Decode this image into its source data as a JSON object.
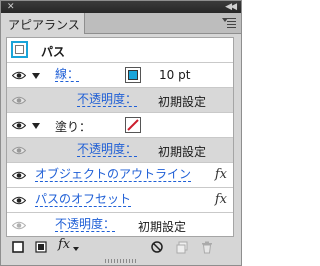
{
  "panel": {
    "title_tab": "アピアランス",
    "close_glyph": "✕",
    "collapse_glyph": "◀◀"
  },
  "header": {
    "object_label": "パス"
  },
  "rows": [
    {
      "label": "線：",
      "value": "10 pt",
      "stroke_color": "#1aa4d9"
    },
    {
      "label": "不透明度：",
      "value": "初期設定"
    },
    {
      "label": "塗り："
    },
    {
      "label": "不透明度：",
      "value": "初期設定"
    },
    {
      "label": "オブジェクトのアウトライン",
      "fx": "fx"
    },
    {
      "label": "パスのオフセット",
      "fx": "fx"
    },
    {
      "label": "不透明度：",
      "value": "初期設定"
    }
  ],
  "toolbar": {
    "fx_label": "fx"
  },
  "colors": {
    "accent": "#1aa4d9",
    "link": "#1f5fd6",
    "no_fill_slash": "#cc1e2e"
  }
}
